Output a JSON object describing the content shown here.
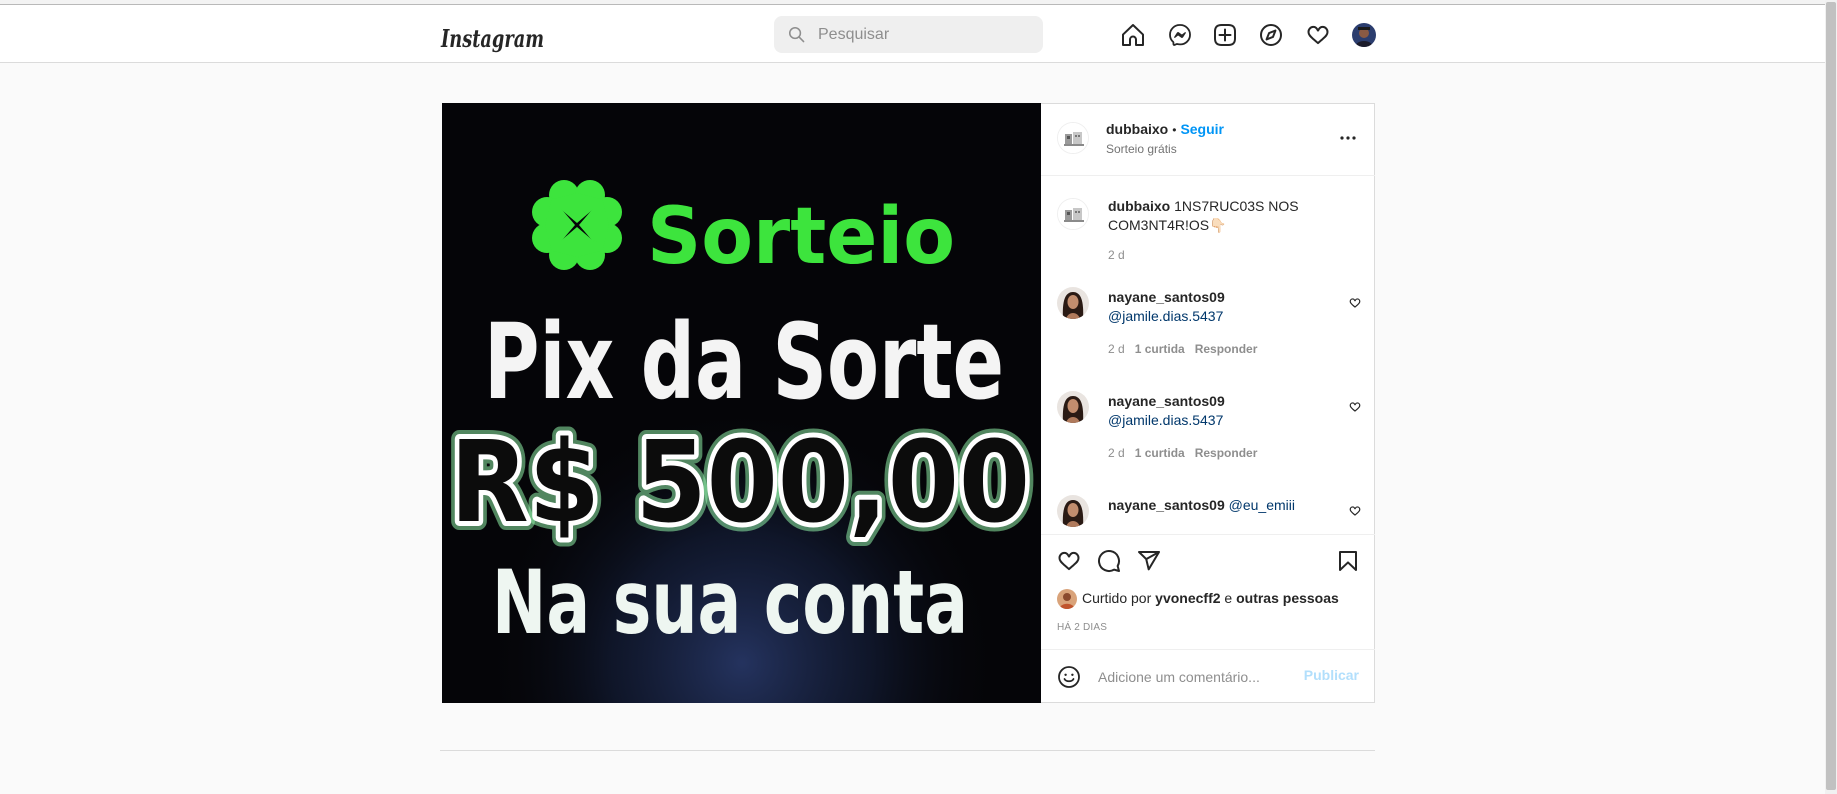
{
  "app": {
    "logo": "Instagram",
    "search": {
      "placeholder": "Pesquisar"
    }
  },
  "nav": {
    "icons": [
      "home-icon",
      "messenger-icon",
      "new-post-icon",
      "explore-icon",
      "activity-heart-icon",
      "profile-avatar"
    ]
  },
  "post": {
    "author": {
      "username": "dubbaixo",
      "separator": "•",
      "follow_label": "Seguir",
      "subtitle": "Sorteio grátis"
    },
    "image_text": {
      "line1": "Sorteio",
      "line2": "Pix da Sorte",
      "line3": "R$ 500,00",
      "line4": "Na sua conta"
    },
    "caption": {
      "username": "dubbaixo",
      "text": "1NS7RUC03S NOS COM3NT4R!OS👇🏻",
      "time": "2 d"
    },
    "comments": [
      {
        "username": "nayane_santos09",
        "text": "@jamile.dias.5437",
        "time": "2 d",
        "likes": "1 curtida",
        "reply": "Responder"
      },
      {
        "username": "nayane_santos09",
        "text": "@jamile.dias.5437",
        "time": "2 d",
        "likes": "1 curtida",
        "reply": "Responder"
      },
      {
        "username": "nayane_santos09",
        "text": "@eu_emiii"
      }
    ],
    "likes": {
      "prefix": "Curtido por",
      "user": "yvonecff2",
      "conjunction": "e",
      "others": "outras pessoas"
    },
    "timestamp": "HÁ 2 DIAS",
    "comment_box": {
      "placeholder": "Adicione um comentário...",
      "publish_label": "Publicar"
    }
  },
  "colors": {
    "accent": "#0095f6",
    "publish_disabled": "#b2dffc",
    "mention": "#00376b",
    "image_green": "#3de43d",
    "image_background": "#050508"
  }
}
